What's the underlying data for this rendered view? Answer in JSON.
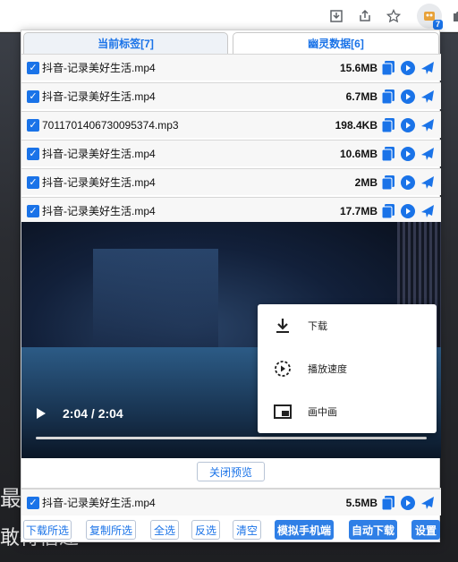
{
  "browser": {
    "extension_badge": "7",
    "icons": [
      "download-icon",
      "share-icon",
      "star-icon",
      "extension-icon",
      "puzzle-icon"
    ]
  },
  "background": {
    "text_1": "最",
    "text_2": "敢待信達"
  },
  "tabs": [
    {
      "label": "当前标签[7]",
      "active": true
    },
    {
      "label": "幽灵数据[6]",
      "active": false
    }
  ],
  "files": [
    {
      "name": "抖音-记录美好生活.mp4",
      "size": "15.6MB",
      "checked": true
    },
    {
      "name": "抖音-记录美好生活.mp4",
      "size": "6.7MB",
      "checked": true
    },
    {
      "name": "7011701406730095374.mp3",
      "size": "198.4KB",
      "checked": true
    },
    {
      "name": "抖音-记录美好生活.mp4",
      "size": "10.6MB",
      "checked": true
    },
    {
      "name": "抖音-记录美好生活.mp4",
      "size": "2MB",
      "checked": true
    },
    {
      "name": "抖音-记录美好生活.mp4",
      "size": "17.7MB",
      "checked": true
    }
  ],
  "player": {
    "time": "2:04 / 2:04",
    "menu": [
      {
        "label": "下载",
        "icon": "download-icon"
      },
      {
        "label": "播放速度",
        "icon": "playback-speed-icon"
      },
      {
        "label": "画中画",
        "icon": "picture-in-picture-icon"
      }
    ]
  },
  "close_preview_label": "关闭预览",
  "last_file": {
    "name": "抖音-记录美好生活.mp4",
    "size": "5.5MB",
    "checked": true
  },
  "buttons": [
    {
      "label": "下载所选",
      "style": "outline"
    },
    {
      "label": "复制所选",
      "style": "outline"
    },
    {
      "label": "全选",
      "style": "outline"
    },
    {
      "label": "反选",
      "style": "outline"
    },
    {
      "label": "清空",
      "style": "outline"
    },
    {
      "label": "模拟手机端",
      "style": "filled"
    },
    {
      "label": "自动下载",
      "style": "filled"
    },
    {
      "label": "设置",
      "style": "filled"
    }
  ],
  "colors": {
    "accent": "#1a73e8",
    "filled_button": "#2f7fe6"
  }
}
